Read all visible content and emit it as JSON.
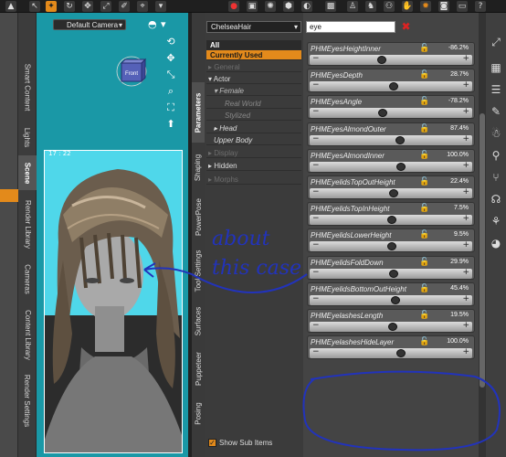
{
  "viewport": {
    "camera": "Default Camera",
    "cube_label": "Front",
    "fps": "17 : 22"
  },
  "left_tabs": [
    "Smart Content",
    "Lights",
    "Scene",
    "Render Library",
    "Cameras",
    "Content Library",
    "Render Settings"
  ],
  "pane_tabs": [
    "Parameters",
    "Shaping",
    "PowerPose",
    "Tool Settings",
    "Surfaces",
    "Puppeteer",
    "Posing"
  ],
  "figure_select": "ChelseaHair",
  "tree": [
    {
      "label": "All",
      "style": "all"
    },
    {
      "label": "Currently Used",
      "style": "used"
    },
    {
      "label": "▸ General",
      "style": "dim"
    },
    {
      "label": "▾ Actor",
      "style": "normal"
    },
    {
      "label": "▾ Female",
      "style": "sub"
    },
    {
      "label": "Real World",
      "style": "subdim"
    },
    {
      "label": "Stylized",
      "style": "subdim"
    },
    {
      "label": "▸ Head",
      "style": "normal2"
    },
    {
      "label": "Upper Body",
      "style": "normal2"
    },
    {
      "label": "▸ Display",
      "style": "dim"
    },
    {
      "label": "▸ Hidden",
      "style": "normal"
    },
    {
      "label": "▸ Morphs",
      "style": "dim"
    }
  ],
  "show_sub_items": "Show Sub Items",
  "search": {
    "value": "eye"
  },
  "properties": [
    {
      "name": "PHMEyesHeightInner",
      "value": "-86.2%",
      "level": -0.862
    },
    {
      "name": "PHMEyesDepth",
      "value": "28.7%",
      "level": 0.287
    },
    {
      "name": "PHMEyesAngle",
      "value": "-78.2%",
      "level": -0.782
    },
    {
      "name": "PHMEyesAlmondOuter",
      "value": "87.4%",
      "level": 0.874
    },
    {
      "name": "PHMEyesAlmondInner",
      "value": "100.0%",
      "level": 1.0
    },
    {
      "name": "PHMEyelidsTopOutHeight",
      "value": "22.4%",
      "level": 0.224
    },
    {
      "name": "PHMEyelidsTopInHeight",
      "value": "7.5%",
      "level": 0.075
    },
    {
      "name": "PHMEyelidsLowerHeight",
      "value": "9.5%",
      "level": 0.095
    },
    {
      "name": "PHMEyelidsFoldDown",
      "value": "29.9%",
      "level": 0.299
    },
    {
      "name": "PHMEyelidsBottomOutHeight",
      "value": "45.4%",
      "level": 0.454
    },
    {
      "name": "PHMEyelashesLength",
      "value": "19.5%",
      "level": 0.195
    },
    {
      "name": "PHMEyelashesHideLayer",
      "value": "100.0%",
      "level": 1.0
    }
  ],
  "annotation": {
    "line1": "about",
    "line2": "this case",
    "color": "#2233bb"
  },
  "colors": {
    "viewport_bg": "#1a98a6",
    "accent": "#e38a1b"
  }
}
